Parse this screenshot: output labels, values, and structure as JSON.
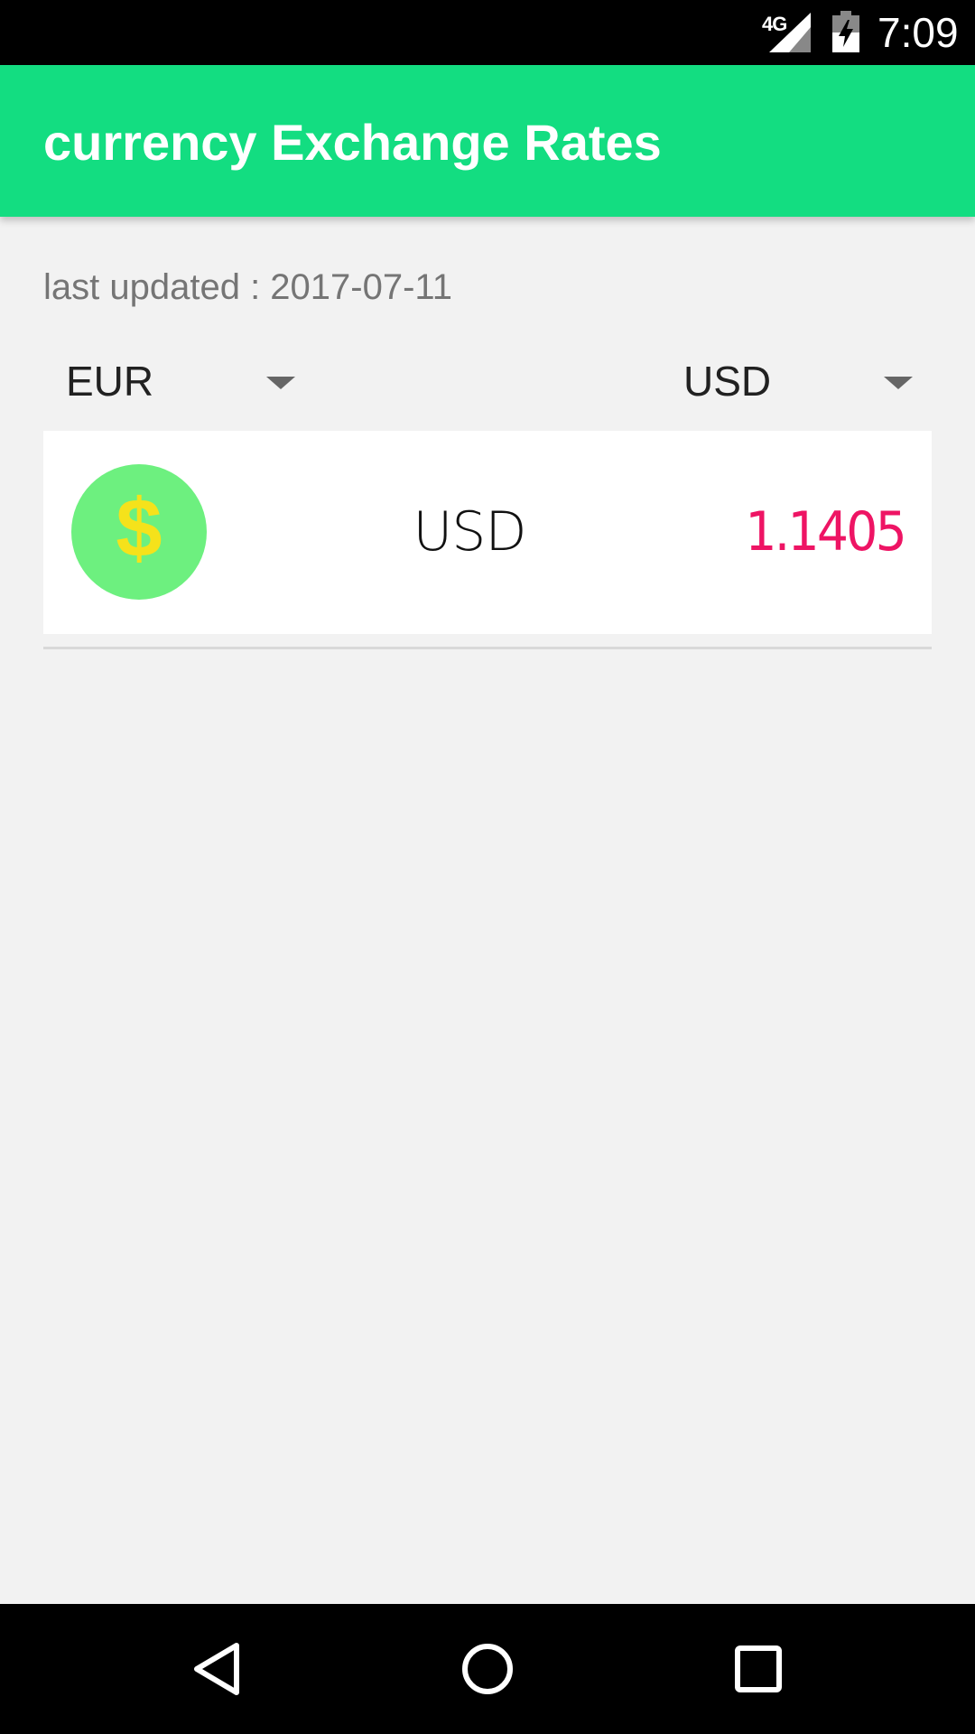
{
  "status_bar": {
    "network": "4G",
    "time": "7:09"
  },
  "app_bar": {
    "title": "currency Exchange Rates"
  },
  "last_updated": {
    "label": "last updated : ",
    "date": "2017-07-11"
  },
  "spinners": {
    "from": {
      "selected": "EUR"
    },
    "to": {
      "selected": "USD"
    }
  },
  "rates": [
    {
      "icon": "dollar-coin-icon",
      "code": "USD",
      "rate": "1.1405"
    }
  ],
  "colors": {
    "app_bar": "#13dd81",
    "coin": "#6df07f",
    "coin_symbol": "#f5e21b",
    "rate_text": "#ee1464",
    "background": "#f2f2f2"
  }
}
